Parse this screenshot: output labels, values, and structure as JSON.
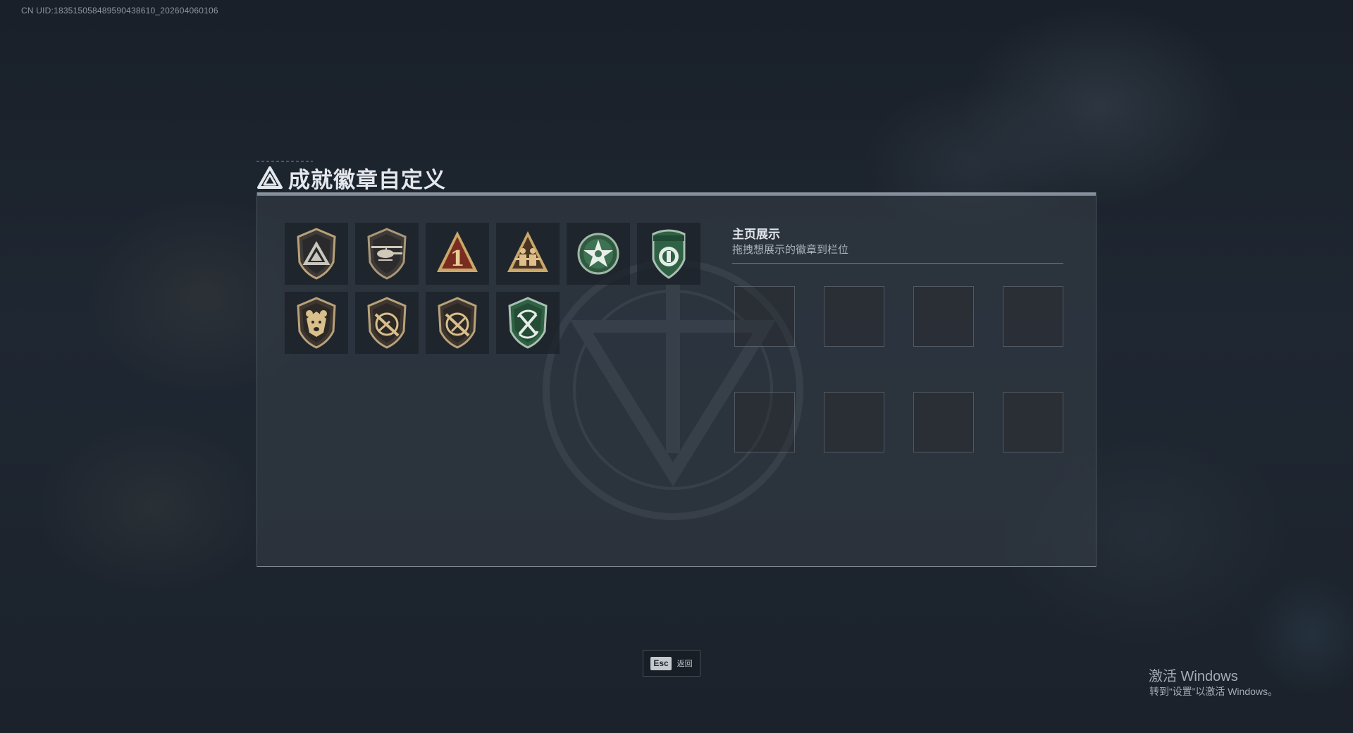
{
  "uid_text": "CN UID:183515058489590438610_202604060106",
  "page_title": "成就徽章自定义",
  "badges": [
    {
      "icon": "shield-triangle-badge-icon"
    },
    {
      "icon": "helicopter-shield-badge-icon"
    },
    {
      "icon": "rank-one-triangle-badge-icon"
    },
    {
      "icon": "soldiers-triangle-badge-icon"
    },
    {
      "icon": "green-star-emblem-badge-icon"
    },
    {
      "icon": "green-crest-badge-icon"
    },
    {
      "icon": "bear-shield-badge-icon"
    },
    {
      "icon": "crossed-rifle-shield-badge-icon"
    },
    {
      "icon": "crossed-rifle-shield-badge-alt-icon"
    },
    {
      "icon": "green-crossed-swords-badge-icon"
    }
  ],
  "showcase": {
    "title": "主页展示",
    "subtitle": "拖拽想展示的徽章到栏位",
    "slot_count": 8
  },
  "footer": {
    "esc_key": "Esc",
    "back_label": "返回"
  },
  "windows_watermark": {
    "title": "激活 Windows",
    "subtitle": "转到“设置”以激活 Windows。"
  },
  "colors": {
    "background": "#1d2530",
    "gold": "#b8a27a",
    "green": "#3c7a55",
    "panel": "#3a424d"
  }
}
